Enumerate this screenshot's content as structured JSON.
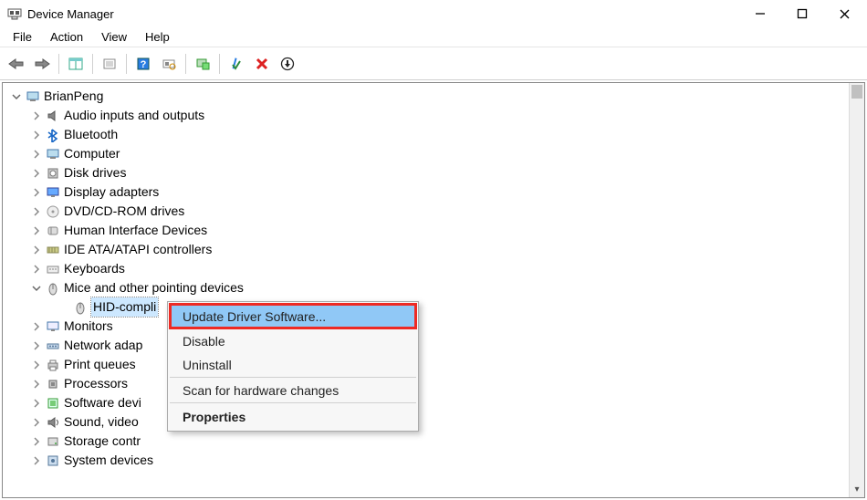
{
  "window": {
    "title": "Device Manager"
  },
  "menu": {
    "items": [
      "File",
      "Action",
      "View",
      "Help"
    ]
  },
  "tree": {
    "root": {
      "label": "BrianPeng",
      "expanded": true
    },
    "categories": [
      {
        "label": "Audio inputs and outputs",
        "icon": "speaker",
        "expanded": false
      },
      {
        "label": "Bluetooth",
        "icon": "bluetooth",
        "expanded": false
      },
      {
        "label": "Computer",
        "icon": "computer",
        "expanded": false
      },
      {
        "label": "Disk drives",
        "icon": "disk",
        "expanded": false
      },
      {
        "label": "Display adapters",
        "icon": "display",
        "expanded": false
      },
      {
        "label": "DVD/CD-ROM drives",
        "icon": "dvd",
        "expanded": false
      },
      {
        "label": "Human Interface Devices",
        "icon": "hid",
        "expanded": false
      },
      {
        "label": "IDE ATA/ATAPI controllers",
        "icon": "ide",
        "expanded": false
      },
      {
        "label": "Keyboards",
        "icon": "keyboard",
        "expanded": false
      },
      {
        "label": "Mice and other pointing devices",
        "icon": "mouse",
        "expanded": true,
        "children": [
          {
            "label": "HID-compli",
            "icon": "mouse",
            "selected": true
          }
        ]
      },
      {
        "label": "Monitors",
        "icon": "monitor",
        "expanded": false
      },
      {
        "label": "Network adap",
        "icon": "network",
        "expanded": false
      },
      {
        "label": "Print queues",
        "icon": "printer",
        "expanded": false
      },
      {
        "label": "Processors",
        "icon": "cpu",
        "expanded": false
      },
      {
        "label": "Software devi",
        "icon": "software",
        "expanded": false
      },
      {
        "label": "Sound, video",
        "icon": "sound",
        "expanded": false
      },
      {
        "label": "Storage contr",
        "icon": "storage",
        "expanded": false
      },
      {
        "label": "System devices",
        "icon": "system",
        "expanded": false
      }
    ]
  },
  "context_menu": {
    "items": [
      {
        "label": "Update Driver Software...",
        "highlighted": true
      },
      {
        "label": "Disable"
      },
      {
        "label": "Uninstall",
        "sep_after": true
      },
      {
        "label": "Scan for hardware changes",
        "sep_after": true
      },
      {
        "label": "Properties",
        "bold": true
      }
    ]
  }
}
